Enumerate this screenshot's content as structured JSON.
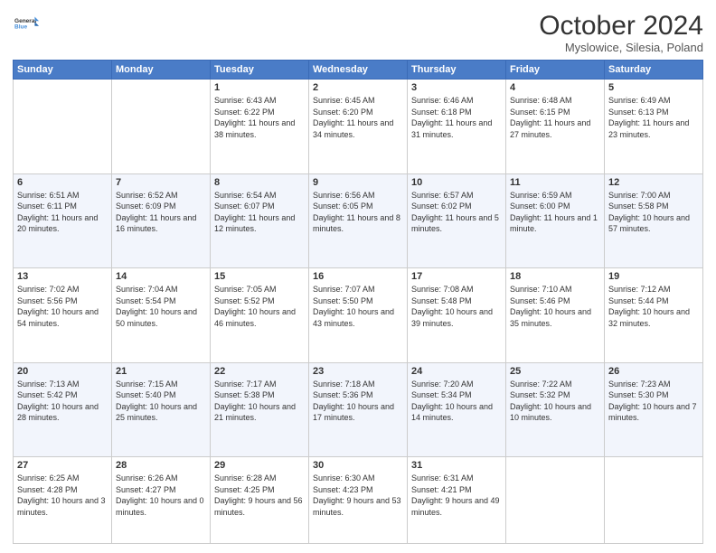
{
  "logo": {
    "line1": "General",
    "line2": "Blue"
  },
  "header": {
    "title": "October 2024",
    "subtitle": "Myslowice, Silesia, Poland"
  },
  "weekdays": [
    "Sunday",
    "Monday",
    "Tuesday",
    "Wednesday",
    "Thursday",
    "Friday",
    "Saturday"
  ],
  "weeks": [
    [
      {
        "day": "",
        "sunrise": "",
        "sunset": "",
        "daylight": ""
      },
      {
        "day": "",
        "sunrise": "",
        "sunset": "",
        "daylight": ""
      },
      {
        "day": "1",
        "sunrise": "Sunrise: 6:43 AM",
        "sunset": "Sunset: 6:22 PM",
        "daylight": "Daylight: 11 hours and 38 minutes."
      },
      {
        "day": "2",
        "sunrise": "Sunrise: 6:45 AM",
        "sunset": "Sunset: 6:20 PM",
        "daylight": "Daylight: 11 hours and 34 minutes."
      },
      {
        "day": "3",
        "sunrise": "Sunrise: 6:46 AM",
        "sunset": "Sunset: 6:18 PM",
        "daylight": "Daylight: 11 hours and 31 minutes."
      },
      {
        "day": "4",
        "sunrise": "Sunrise: 6:48 AM",
        "sunset": "Sunset: 6:15 PM",
        "daylight": "Daylight: 11 hours and 27 minutes."
      },
      {
        "day": "5",
        "sunrise": "Sunrise: 6:49 AM",
        "sunset": "Sunset: 6:13 PM",
        "daylight": "Daylight: 11 hours and 23 minutes."
      }
    ],
    [
      {
        "day": "6",
        "sunrise": "Sunrise: 6:51 AM",
        "sunset": "Sunset: 6:11 PM",
        "daylight": "Daylight: 11 hours and 20 minutes."
      },
      {
        "day": "7",
        "sunrise": "Sunrise: 6:52 AM",
        "sunset": "Sunset: 6:09 PM",
        "daylight": "Daylight: 11 hours and 16 minutes."
      },
      {
        "day": "8",
        "sunrise": "Sunrise: 6:54 AM",
        "sunset": "Sunset: 6:07 PM",
        "daylight": "Daylight: 11 hours and 12 minutes."
      },
      {
        "day": "9",
        "sunrise": "Sunrise: 6:56 AM",
        "sunset": "Sunset: 6:05 PM",
        "daylight": "Daylight: 11 hours and 8 minutes."
      },
      {
        "day": "10",
        "sunrise": "Sunrise: 6:57 AM",
        "sunset": "Sunset: 6:02 PM",
        "daylight": "Daylight: 11 hours and 5 minutes."
      },
      {
        "day": "11",
        "sunrise": "Sunrise: 6:59 AM",
        "sunset": "Sunset: 6:00 PM",
        "daylight": "Daylight: 11 hours and 1 minute."
      },
      {
        "day": "12",
        "sunrise": "Sunrise: 7:00 AM",
        "sunset": "Sunset: 5:58 PM",
        "daylight": "Daylight: 10 hours and 57 minutes."
      }
    ],
    [
      {
        "day": "13",
        "sunrise": "Sunrise: 7:02 AM",
        "sunset": "Sunset: 5:56 PM",
        "daylight": "Daylight: 10 hours and 54 minutes."
      },
      {
        "day": "14",
        "sunrise": "Sunrise: 7:04 AM",
        "sunset": "Sunset: 5:54 PM",
        "daylight": "Daylight: 10 hours and 50 minutes."
      },
      {
        "day": "15",
        "sunrise": "Sunrise: 7:05 AM",
        "sunset": "Sunset: 5:52 PM",
        "daylight": "Daylight: 10 hours and 46 minutes."
      },
      {
        "day": "16",
        "sunrise": "Sunrise: 7:07 AM",
        "sunset": "Sunset: 5:50 PM",
        "daylight": "Daylight: 10 hours and 43 minutes."
      },
      {
        "day": "17",
        "sunrise": "Sunrise: 7:08 AM",
        "sunset": "Sunset: 5:48 PM",
        "daylight": "Daylight: 10 hours and 39 minutes."
      },
      {
        "day": "18",
        "sunrise": "Sunrise: 7:10 AM",
        "sunset": "Sunset: 5:46 PM",
        "daylight": "Daylight: 10 hours and 35 minutes."
      },
      {
        "day": "19",
        "sunrise": "Sunrise: 7:12 AM",
        "sunset": "Sunset: 5:44 PM",
        "daylight": "Daylight: 10 hours and 32 minutes."
      }
    ],
    [
      {
        "day": "20",
        "sunrise": "Sunrise: 7:13 AM",
        "sunset": "Sunset: 5:42 PM",
        "daylight": "Daylight: 10 hours and 28 minutes."
      },
      {
        "day": "21",
        "sunrise": "Sunrise: 7:15 AM",
        "sunset": "Sunset: 5:40 PM",
        "daylight": "Daylight: 10 hours and 25 minutes."
      },
      {
        "day": "22",
        "sunrise": "Sunrise: 7:17 AM",
        "sunset": "Sunset: 5:38 PM",
        "daylight": "Daylight: 10 hours and 21 minutes."
      },
      {
        "day": "23",
        "sunrise": "Sunrise: 7:18 AM",
        "sunset": "Sunset: 5:36 PM",
        "daylight": "Daylight: 10 hours and 17 minutes."
      },
      {
        "day": "24",
        "sunrise": "Sunrise: 7:20 AM",
        "sunset": "Sunset: 5:34 PM",
        "daylight": "Daylight: 10 hours and 14 minutes."
      },
      {
        "day": "25",
        "sunrise": "Sunrise: 7:22 AM",
        "sunset": "Sunset: 5:32 PM",
        "daylight": "Daylight: 10 hours and 10 minutes."
      },
      {
        "day": "26",
        "sunrise": "Sunrise: 7:23 AM",
        "sunset": "Sunset: 5:30 PM",
        "daylight": "Daylight: 10 hours and 7 minutes."
      }
    ],
    [
      {
        "day": "27",
        "sunrise": "Sunrise: 6:25 AM",
        "sunset": "Sunset: 4:28 PM",
        "daylight": "Daylight: 10 hours and 3 minutes."
      },
      {
        "day": "28",
        "sunrise": "Sunrise: 6:26 AM",
        "sunset": "Sunset: 4:27 PM",
        "daylight": "Daylight: 10 hours and 0 minutes."
      },
      {
        "day": "29",
        "sunrise": "Sunrise: 6:28 AM",
        "sunset": "Sunset: 4:25 PM",
        "daylight": "Daylight: 9 hours and 56 minutes."
      },
      {
        "day": "30",
        "sunrise": "Sunrise: 6:30 AM",
        "sunset": "Sunset: 4:23 PM",
        "daylight": "Daylight: 9 hours and 53 minutes."
      },
      {
        "day": "31",
        "sunrise": "Sunrise: 6:31 AM",
        "sunset": "Sunset: 4:21 PM",
        "daylight": "Daylight: 9 hours and 49 minutes."
      },
      {
        "day": "",
        "sunrise": "",
        "sunset": "",
        "daylight": ""
      },
      {
        "day": "",
        "sunrise": "",
        "sunset": "",
        "daylight": ""
      }
    ]
  ]
}
